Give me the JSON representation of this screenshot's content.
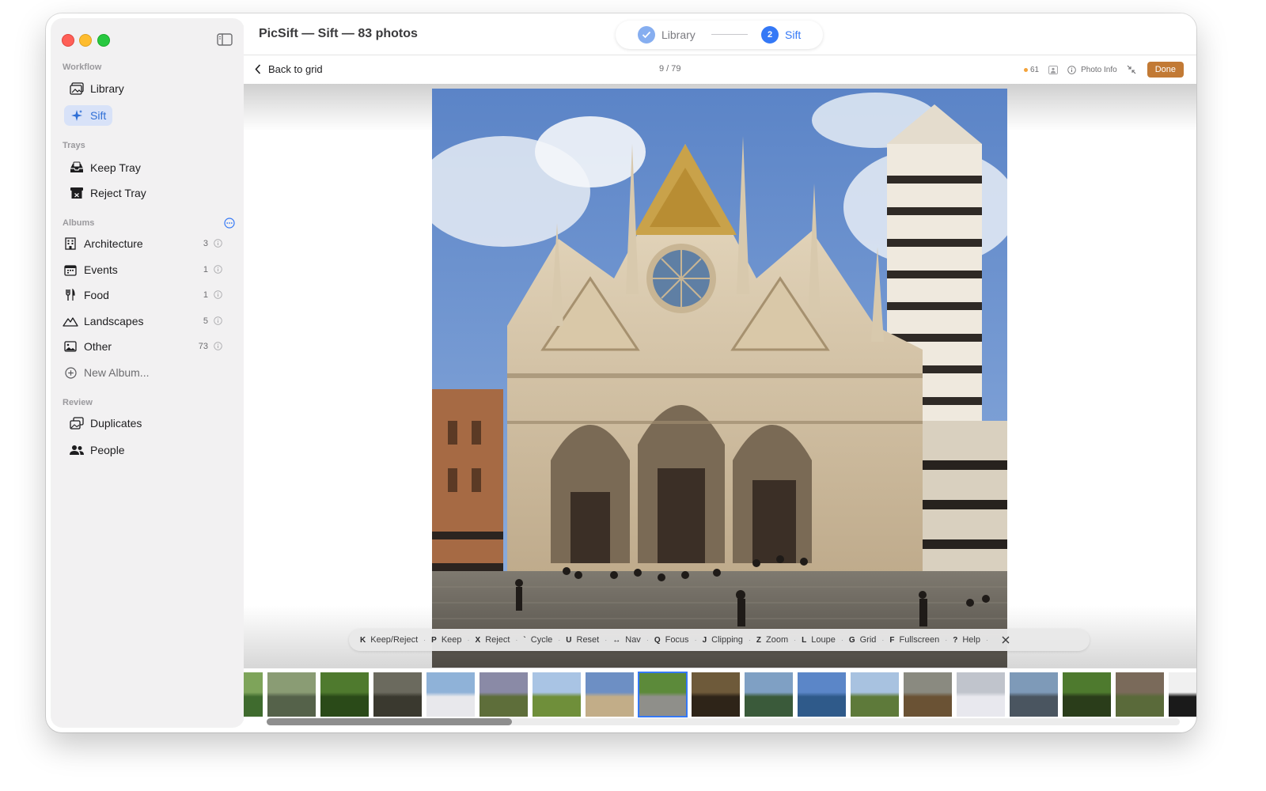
{
  "window": {
    "title": "PicSift — Sift — 83 photos"
  },
  "stepper": {
    "step1_label": "Library",
    "step2_number": "2",
    "step2_label": "Sift"
  },
  "sidebar": {
    "workflow_header": "Workflow",
    "workflow": [
      {
        "label": "Library",
        "icon": "photo-library-icon"
      },
      {
        "label": "Sift",
        "icon": "sparkle-icon"
      }
    ],
    "trays_header": "Trays",
    "trays": [
      {
        "label": "Keep Tray",
        "icon": "tray-icon"
      },
      {
        "label": "Reject Tray",
        "icon": "archive-box-icon"
      }
    ],
    "albums_header": "Albums",
    "albums": [
      {
        "label": "Architecture",
        "count": "3",
        "icon": "building-icon"
      },
      {
        "label": "Events",
        "count": "1",
        "icon": "calendar-icon"
      },
      {
        "label": "Food",
        "count": "1",
        "icon": "fork-knife-icon"
      },
      {
        "label": "Landscapes",
        "count": "5",
        "icon": "mountain-icon"
      },
      {
        "label": "Other",
        "count": "73",
        "icon": "photo-icon"
      }
    ],
    "new_album": "New Album...",
    "review_header": "Review",
    "review": [
      {
        "label": "Duplicates",
        "icon": "duplicates-icon"
      },
      {
        "label": "People",
        "icon": "people-icon"
      }
    ]
  },
  "subbar": {
    "back_label": "Back to grid",
    "position": "9 / 79",
    "kept_count": "61",
    "photo_info": "Photo Info",
    "done": "Done"
  },
  "hotkeys": [
    {
      "key": "K",
      "action": "Keep/Reject"
    },
    {
      "key": "P",
      "action": "Keep"
    },
    {
      "key": "X",
      "action": "Reject"
    },
    {
      "key": "`",
      "action": "Cycle"
    },
    {
      "key": "U",
      "action": "Reset"
    },
    {
      "key": "↔",
      "action": "Nav"
    },
    {
      "key": "Q",
      "action": "Focus"
    },
    {
      "key": "J",
      "action": "Clipping"
    },
    {
      "key": "Z",
      "action": "Zoom"
    },
    {
      "key": "L",
      "action": "Loupe"
    },
    {
      "key": "G",
      "action": "Grid"
    },
    {
      "key": "F",
      "action": "Fullscreen"
    },
    {
      "key": "?",
      "action": "Help"
    }
  ],
  "filmstrip": {
    "selected_index": 7,
    "count": 18
  },
  "colors": {
    "accent": "#3478f6",
    "done_button": "#c27a35",
    "kept_dot": "#f3a33b"
  }
}
